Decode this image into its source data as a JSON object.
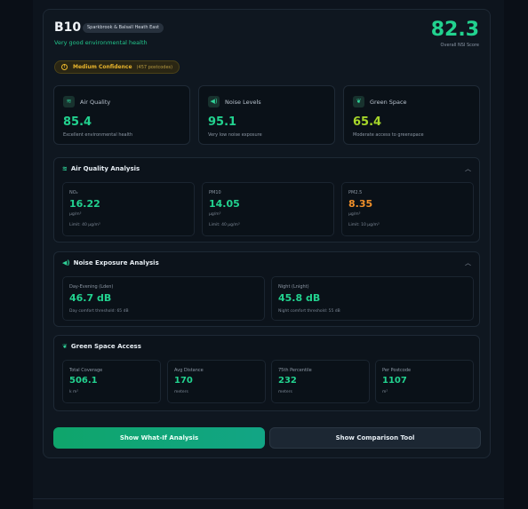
{
  "header": {
    "postcode": "B10",
    "area": "Sparkbrook & Balsall Heath East",
    "tagline": "Very good environmental health",
    "score": "82.3",
    "score_label": "Overall NSI Score"
  },
  "confidence": {
    "label": "Medium Confidence",
    "detail": "(457 postcodes)"
  },
  "metrics": [
    {
      "title": "Air Quality",
      "value": "85.4",
      "description": "Excellent environmental health",
      "color": "#22d28f",
      "icon": "air-icon"
    },
    {
      "title": "Noise Levels",
      "value": "95.1",
      "description": "Very low noise exposure",
      "color": "#22d28f",
      "icon": "speaker-icon"
    },
    {
      "title": "Green Space",
      "value": "65.4",
      "description": "Moderate access to greenspace",
      "color": "#a6d62a",
      "icon": "leaf-icon"
    }
  ],
  "air_section": {
    "title": "Air Quality Analysis",
    "cards": [
      {
        "label": "NO₂",
        "value": "16.22",
        "unit": "μg/m³",
        "limit": "Limit: 40 μg/m³",
        "color": "#22d28f"
      },
      {
        "label": "PM10",
        "value": "14.05",
        "unit": "μg/m³",
        "limit": "Limit: 40 μg/m³",
        "color": "#22d28f"
      },
      {
        "label": "PM2.5",
        "value": "8.35",
        "unit": "μg/m³",
        "limit": "Limit: 10 μg/m³",
        "color": "#f0902a"
      }
    ]
  },
  "noise_section": {
    "title": "Noise Exposure Analysis",
    "cards": [
      {
        "label": "Day-Evening (Lden)",
        "value": "46.7 dB",
        "note": "Day comfort threshold: 65 dB",
        "color": "#22d28f"
      },
      {
        "label": "Night (Lnight)",
        "value": "45.8 dB",
        "note": "Night comfort threshold: 55 dB",
        "color": "#22d28f"
      }
    ]
  },
  "green_section": {
    "title": "Green Space Access",
    "cards": [
      {
        "label": "Total Coverage",
        "value": "506.1",
        "unit": "k m²"
      },
      {
        "label": "Avg Distance",
        "value": "170",
        "unit": "meters"
      },
      {
        "label": "75th Percentile",
        "value": "232",
        "unit": "meters"
      },
      {
        "label": "Per Postcode",
        "value": "1107",
        "unit": "m²"
      }
    ]
  },
  "buttons": {
    "what_if": "Show What-If Analysis",
    "comparison": "Show Comparison Tool"
  },
  "colors": {
    "accent": "#22d28f",
    "warning": "#e9b52c",
    "orange": "#f0902a",
    "lime": "#a6d62a"
  }
}
